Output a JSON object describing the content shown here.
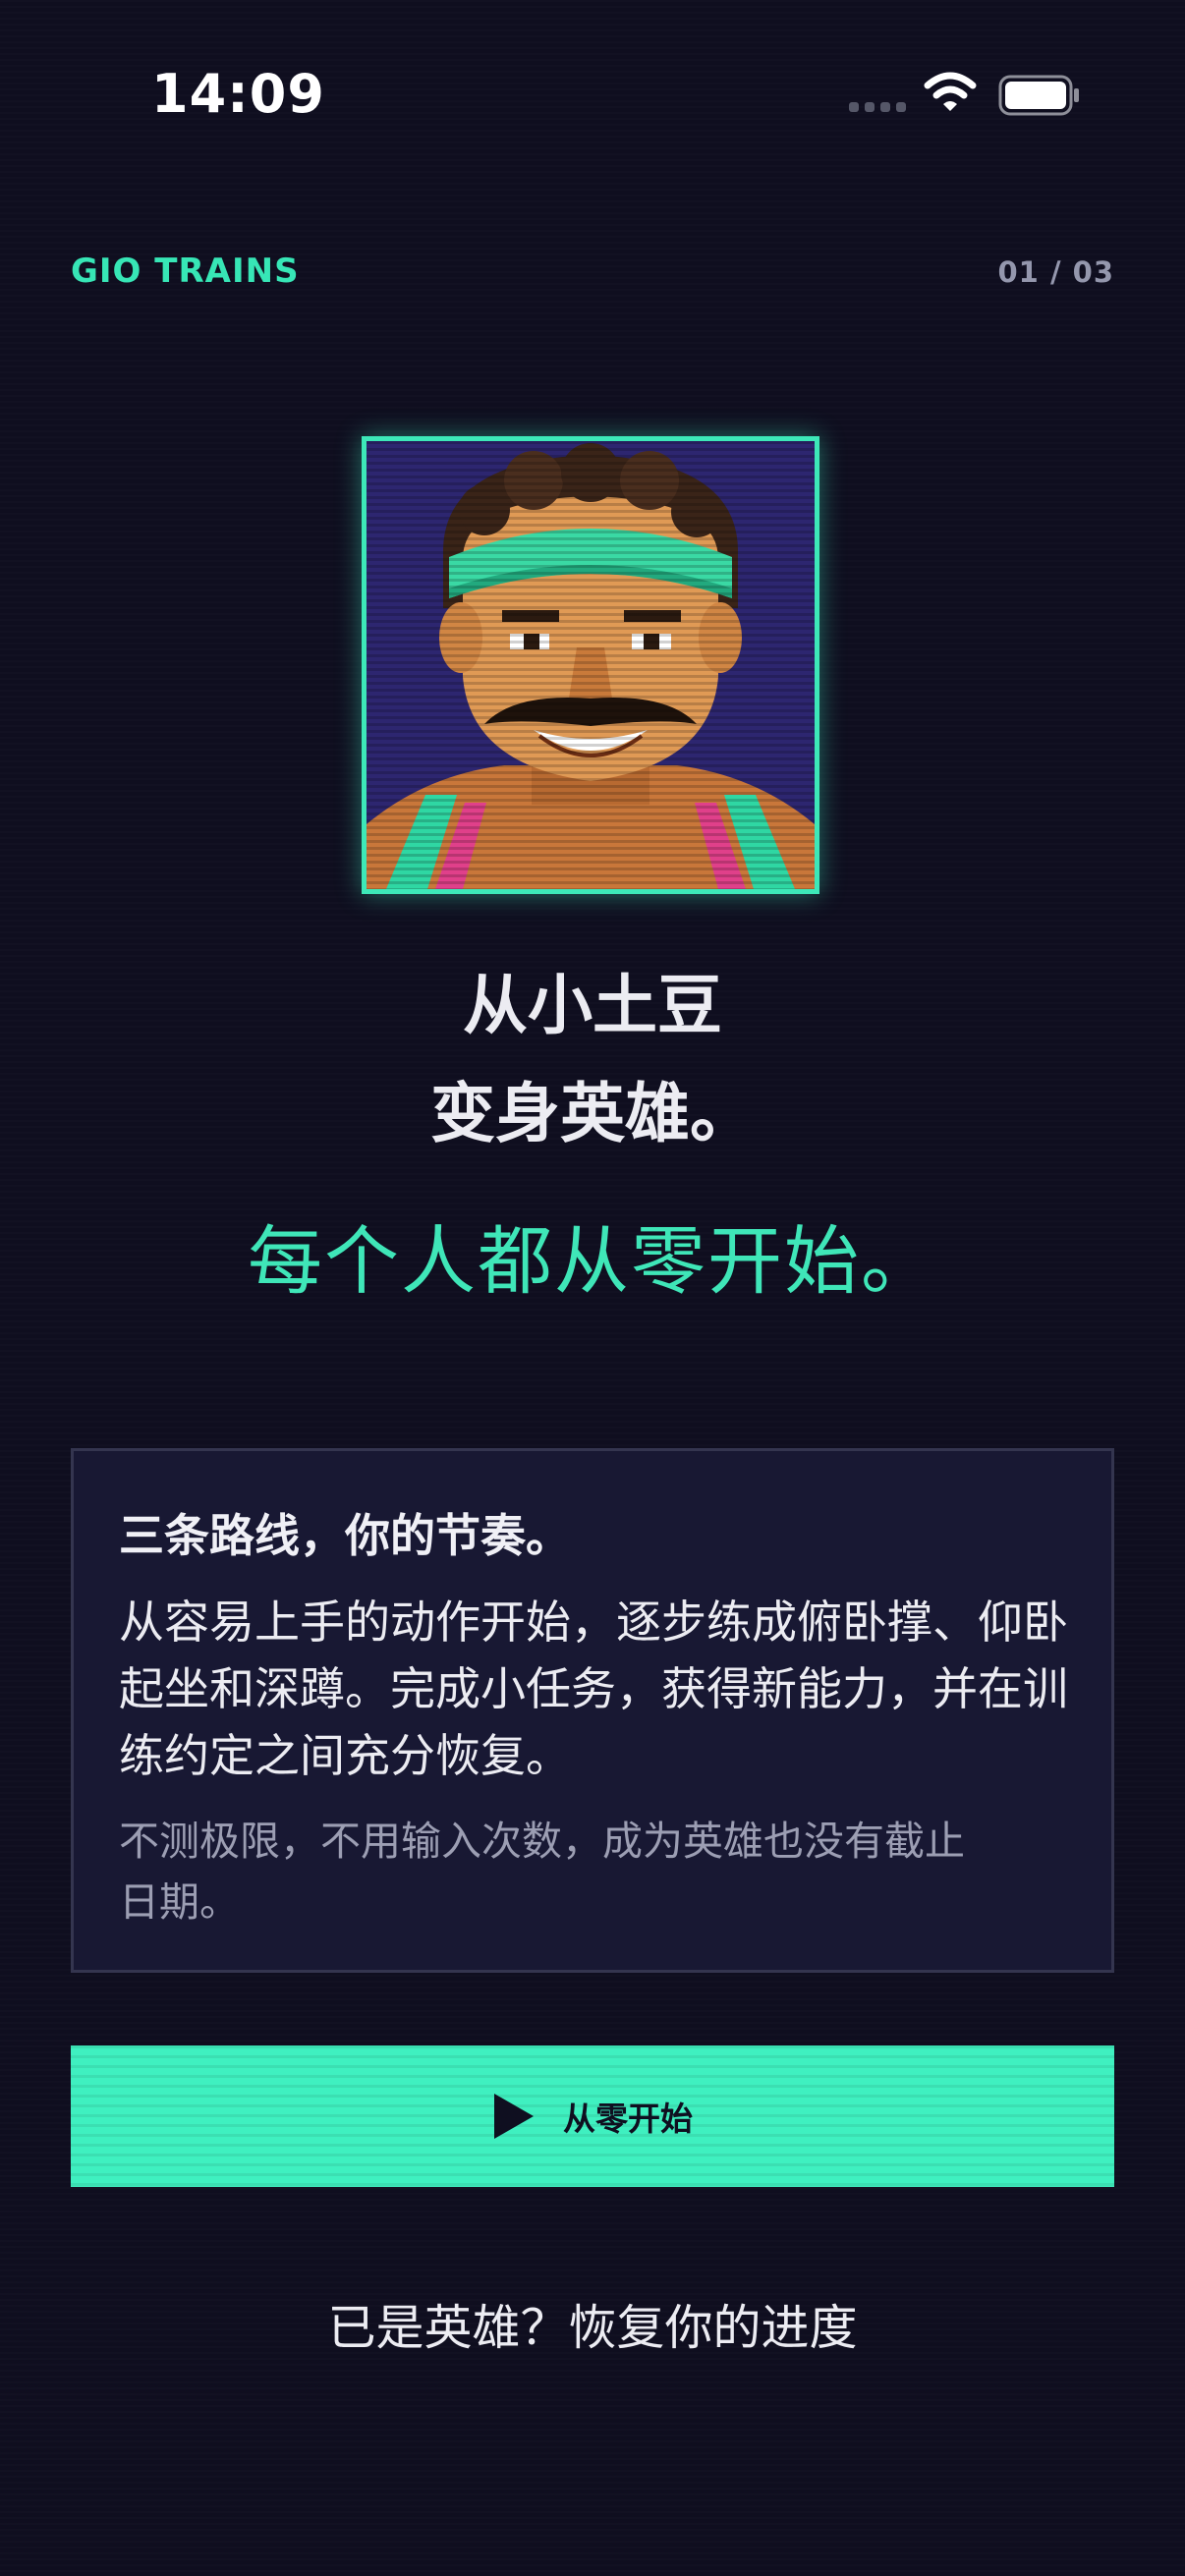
{
  "status_bar": {
    "time": "14:09",
    "icons": [
      "cellular-signal-icon",
      "wifi-icon",
      "battery-icon"
    ]
  },
  "header": {
    "brand": "GIO TRAINS",
    "pager": "01 / 03"
  },
  "hero": {
    "image": "pixel-art-hero-portrait",
    "headline_line1": "从小土豆",
    "headline_line2": "变身英雄。",
    "tagline": "每个人都从零开始。"
  },
  "info_card": {
    "title": "三条路线，你的节奏。",
    "body": "从容易上手的动作开始，逐步练成俯卧撑、仰卧起坐和深蹲。完成小任务，获得新能力，并在训练约定之间充分恢复。",
    "note": "不测极限，不用输入次数，成为英雄也没有截止日期。"
  },
  "primary_button": {
    "icon": "play-icon",
    "label": "从零开始"
  },
  "restore_link": {
    "label": "已是英雄？恢复你的进度"
  },
  "colors": {
    "background": "#0f0e1f",
    "accent": "#3fe6b8",
    "card_bg": "#181833",
    "muted_text": "#9c9eb3"
  }
}
